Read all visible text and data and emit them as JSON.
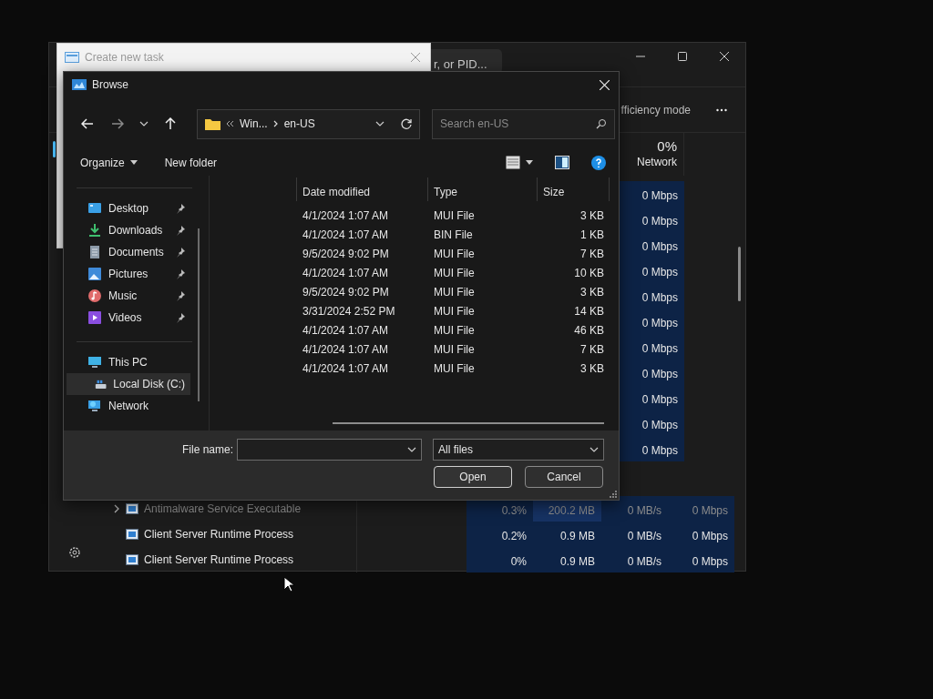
{
  "task_manager": {
    "search_placeholder": "r, or PID...",
    "toolbar_text": "fficiency mode",
    "network_header": {
      "percent": "0%",
      "label": "Network"
    },
    "network_cells": [
      "0 Mbps",
      "0 Mbps",
      "0 Mbps",
      "0 Mbps",
      "0 Mbps",
      "0 Mbps",
      "0 Mbps",
      "0 Mbps",
      "0 Mbps",
      "0 Mbps",
      "0 Mbps"
    ],
    "processes": [
      {
        "name": "Antimalware Service Executable",
        "expandable": true,
        "dimmed": true,
        "cpu": "0.3%",
        "memory": "200.2 MB",
        "disk": "0 MB/s",
        "network": "0 Mbps"
      },
      {
        "name": "Client Server Runtime Process",
        "expandable": false,
        "dimmed": false,
        "cpu": "0.2%",
        "memory": "0.9 MB",
        "disk": "0 MB/s",
        "network": "0 Mbps"
      },
      {
        "name": "Client Server Runtime Process",
        "expandable": false,
        "dimmed": false,
        "cpu": "0%",
        "memory": "0.9 MB",
        "disk": "0 MB/s",
        "network": "0 Mbps"
      }
    ]
  },
  "create_task": {
    "title": "Create new task",
    "active": false
  },
  "browse": {
    "title": "Browse",
    "path": [
      "Win...",
      "en-US"
    ],
    "search_placeholder": "Search en-US",
    "commands": [
      "Organize",
      "New folder"
    ],
    "nav": [
      {
        "items": [
          {
            "label": "Desktop",
            "kind": "desktop",
            "pinned": true,
            "selected": false
          },
          {
            "label": "Downloads",
            "kind": "downloads",
            "pinned": true,
            "selected": false
          },
          {
            "label": "Documents",
            "kind": "documents",
            "pinned": true,
            "selected": false
          },
          {
            "label": "Pictures",
            "kind": "pictures",
            "pinned": true,
            "selected": false
          },
          {
            "label": "Music",
            "kind": "music",
            "pinned": true,
            "selected": false
          },
          {
            "label": "Videos",
            "kind": "videos",
            "pinned": true,
            "selected": false
          }
        ]
      },
      {
        "items": [
          {
            "label": "This PC",
            "kind": "pc",
            "pinned": false,
            "selected": false,
            "children": [
              {
                "label": "Local Disk (C:)",
                "kind": "disk",
                "pinned": false,
                "selected": true
              }
            ]
          },
          {
            "label": "Network",
            "kind": "network",
            "pinned": false,
            "selected": false
          }
        ]
      }
    ],
    "columns": [
      "Date modified",
      "Type",
      "Size"
    ],
    "rows": [
      [
        "4/1/2024 1:07 AM",
        "MUI File",
        "3 KB"
      ],
      [
        "4/1/2024 1:07 AM",
        "BIN File",
        "1 KB"
      ],
      [
        "9/5/2024 9:02 PM",
        "MUI File",
        "7 KB"
      ],
      [
        "4/1/2024 1:07 AM",
        "MUI File",
        "10 KB"
      ],
      [
        "9/5/2024 9:02 PM",
        "MUI File",
        "3 KB"
      ],
      [
        "3/31/2024 2:52 PM",
        "MUI File",
        "14 KB"
      ],
      [
        "4/1/2024 1:07 AM",
        "MUI File",
        "46 KB"
      ],
      [
        "4/1/2024 1:07 AM",
        "MUI File",
        "7 KB"
      ],
      [
        "4/1/2024 1:07 AM",
        "MUI File",
        "3 KB"
      ]
    ],
    "file_name_label": "File name:",
    "file_type": "All files",
    "buttons": [
      "Open",
      "Cancel"
    ]
  }
}
